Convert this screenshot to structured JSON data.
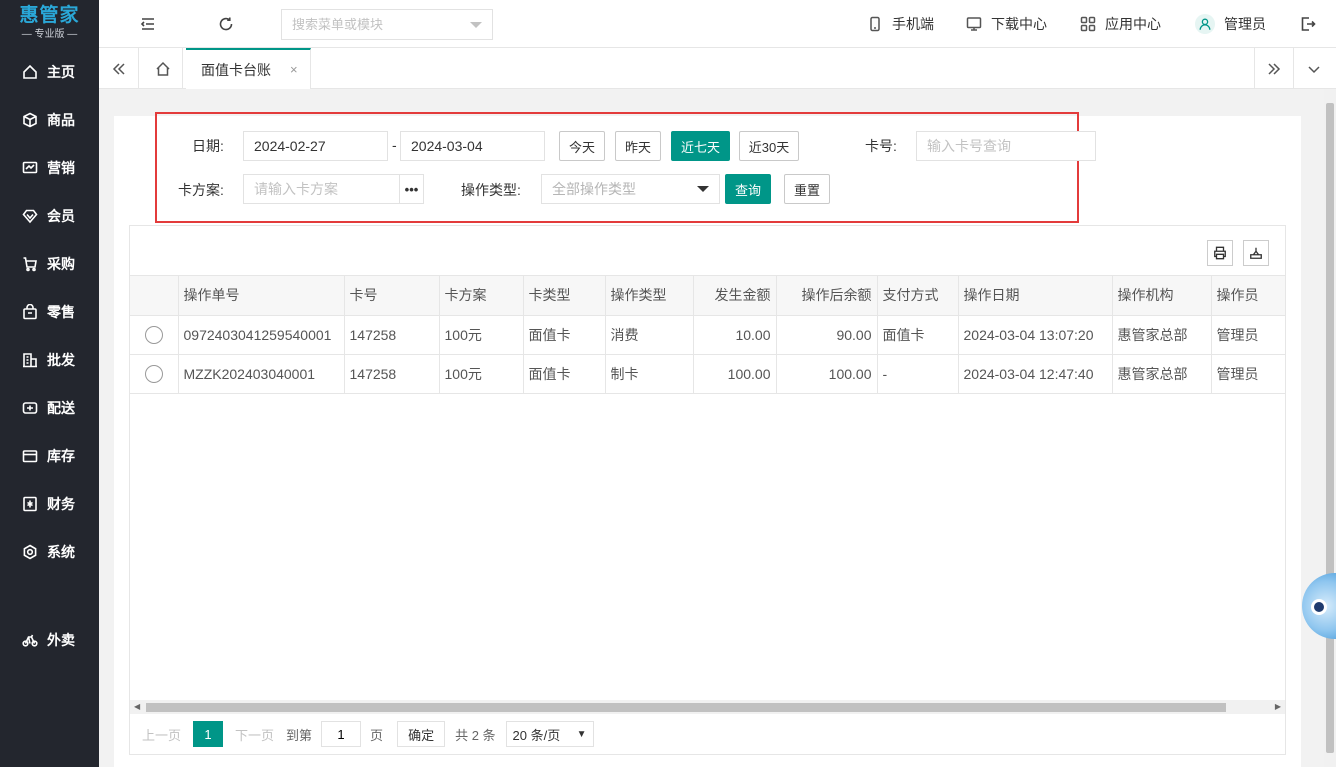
{
  "logo": {
    "main": "惠管家",
    "sub": "— 专业版 —"
  },
  "sidebar": {
    "items": [
      {
        "label": "主页",
        "icon": "home-icon"
      },
      {
        "label": "商品",
        "icon": "box-icon"
      },
      {
        "label": "营销",
        "icon": "chart-icon"
      },
      {
        "label": "会员",
        "icon": "diamond-icon"
      },
      {
        "label": "采购",
        "icon": "cart-icon"
      },
      {
        "label": "零售",
        "icon": "bag-icon"
      },
      {
        "label": "批发",
        "icon": "building-icon"
      },
      {
        "label": "配送",
        "icon": "truck-icon"
      },
      {
        "label": "库存",
        "icon": "inventory-icon"
      },
      {
        "label": "财务",
        "icon": "finance-icon"
      },
      {
        "label": "系统",
        "icon": "settings-icon"
      }
    ],
    "extra": {
      "label": "外卖",
      "icon": "bike-icon"
    }
  },
  "header": {
    "search_placeholder": "搜索菜单或模块",
    "mobile": "手机端",
    "download": "下载中心",
    "apps": "应用中心",
    "user": "管理员"
  },
  "tabs": {
    "active": "面值卡台账",
    "close": "×"
  },
  "filters": {
    "date_label": "日期:",
    "date_from": "2024-02-27",
    "date_sep": "-",
    "date_to": "2024-03-04",
    "btn_today": "今天",
    "btn_yesterday": "昨天",
    "btn_7days": "近七天",
    "btn_30days": "近30天",
    "card_no_label": "卡号:",
    "card_no_placeholder": "输入卡号查询",
    "plan_label": "卡方案:",
    "plan_placeholder": "请输入卡方案",
    "plan_more": "•••",
    "op_type_label": "操作类型:",
    "op_type_value": "全部操作类型",
    "btn_query": "查询",
    "btn_reset": "重置"
  },
  "table": {
    "columns": [
      "操作单号",
      "卡号",
      "卡方案",
      "卡类型",
      "操作类型",
      "发生金额",
      "操作后余额",
      "支付方式",
      "操作日期",
      "操作机构",
      "操作员"
    ],
    "rows": [
      [
        "0972403041259540001",
        "147258",
        "100元",
        "面值卡",
        "消费",
        "10.00",
        "90.00",
        "面值卡",
        "2024-03-04 13:07:20",
        "惠管家总部",
        "管理员"
      ],
      [
        "MZZK202403040001",
        "147258",
        "100元",
        "面值卡",
        "制卡",
        "100.00",
        "100.00",
        "-",
        "2024-03-04 12:47:40",
        "惠管家总部",
        "管理员"
      ]
    ]
  },
  "pager": {
    "prev": "上一页",
    "current": "1",
    "next": "下一页",
    "goto": "到第",
    "goto_value": "1",
    "page_unit": "页",
    "confirm": "确定",
    "total": "共 2 条",
    "page_size": "20 条/页"
  }
}
